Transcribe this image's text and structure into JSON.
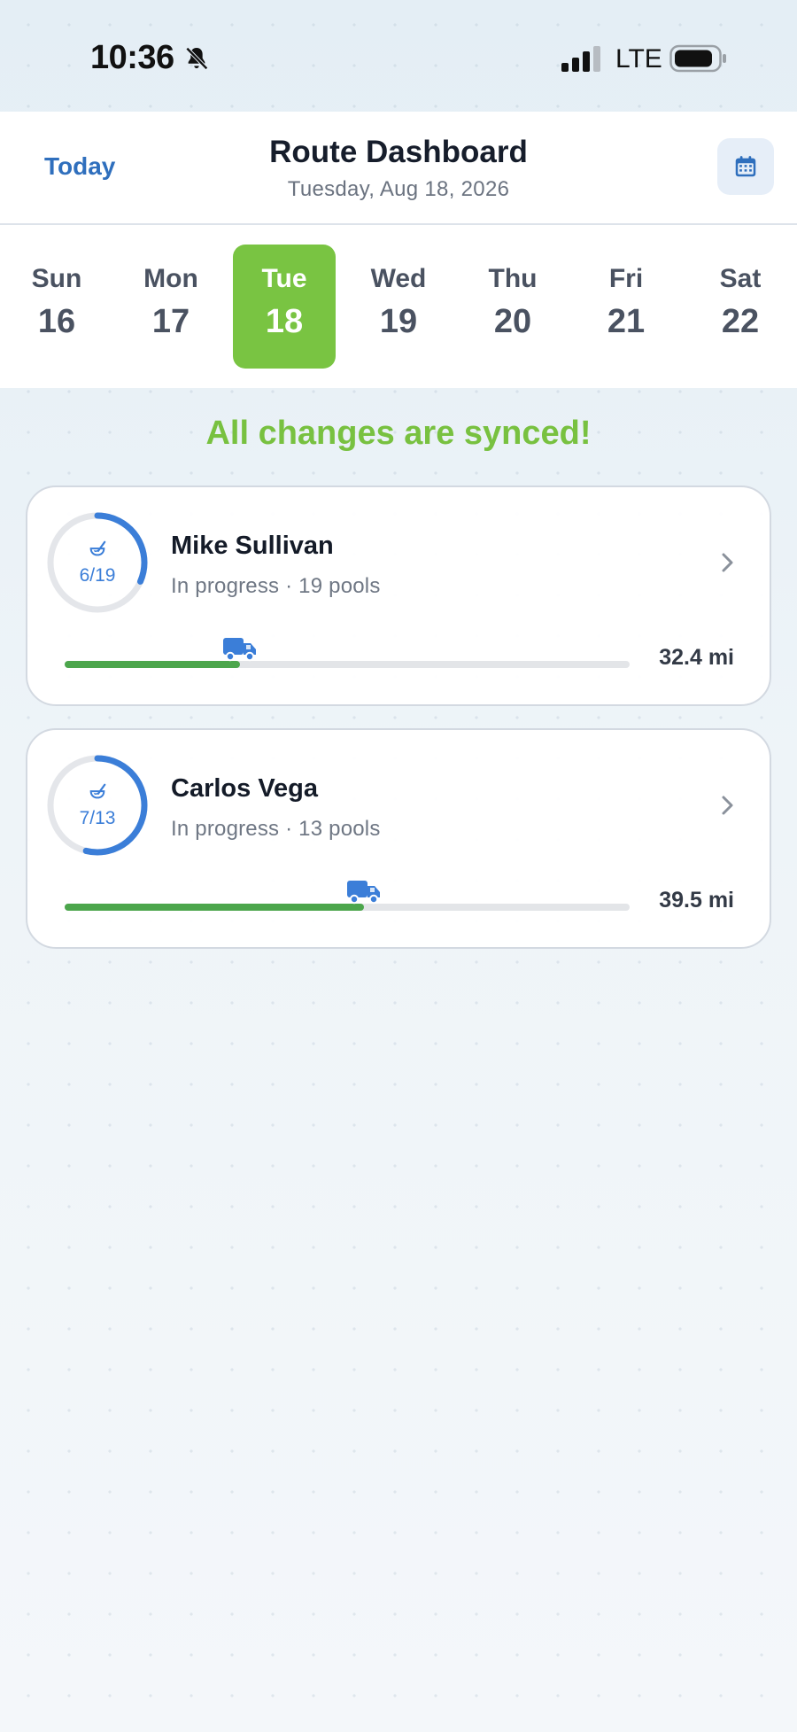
{
  "status_bar": {
    "time": "10:36",
    "network": "LTE",
    "icons": [
      "bell-slash-icon",
      "signal-icon",
      "battery-icon"
    ]
  },
  "header": {
    "today_label": "Today",
    "title": "Route Dashboard",
    "subtitle": "Tuesday, Aug 18, 2026",
    "calendar_icon": "calendar-icon"
  },
  "week": {
    "selected_index": 2,
    "days": [
      {
        "name": "Sun",
        "num": "16"
      },
      {
        "name": "Mon",
        "num": "17"
      },
      {
        "name": "Tue",
        "num": "18"
      },
      {
        "name": "Wed",
        "num": "19"
      },
      {
        "name": "Thu",
        "num": "20"
      },
      {
        "name": "Fri",
        "num": "21"
      },
      {
        "name": "Sat",
        "num": "22"
      }
    ]
  },
  "sync": {
    "message": "All changes are synced!",
    "color": "#78c140"
  },
  "routes": [
    {
      "tech": "Mike Sullivan",
      "status": "In progress · 19 pools",
      "count_label": "6/19",
      "completed": 6,
      "total": 19,
      "route_progress": 0.31,
      "distance": "32.4 mi"
    },
    {
      "tech": "Carlos Vega",
      "status": "In progress · 13 pools",
      "count_label": "7/13",
      "completed": 7,
      "total": 13,
      "route_progress": 0.53,
      "distance": "39.5 mi"
    }
  ],
  "colors": {
    "accent_blue": "#3b7ed8",
    "selected_day": "#79c442",
    "progress_green": "#4ca64c"
  }
}
